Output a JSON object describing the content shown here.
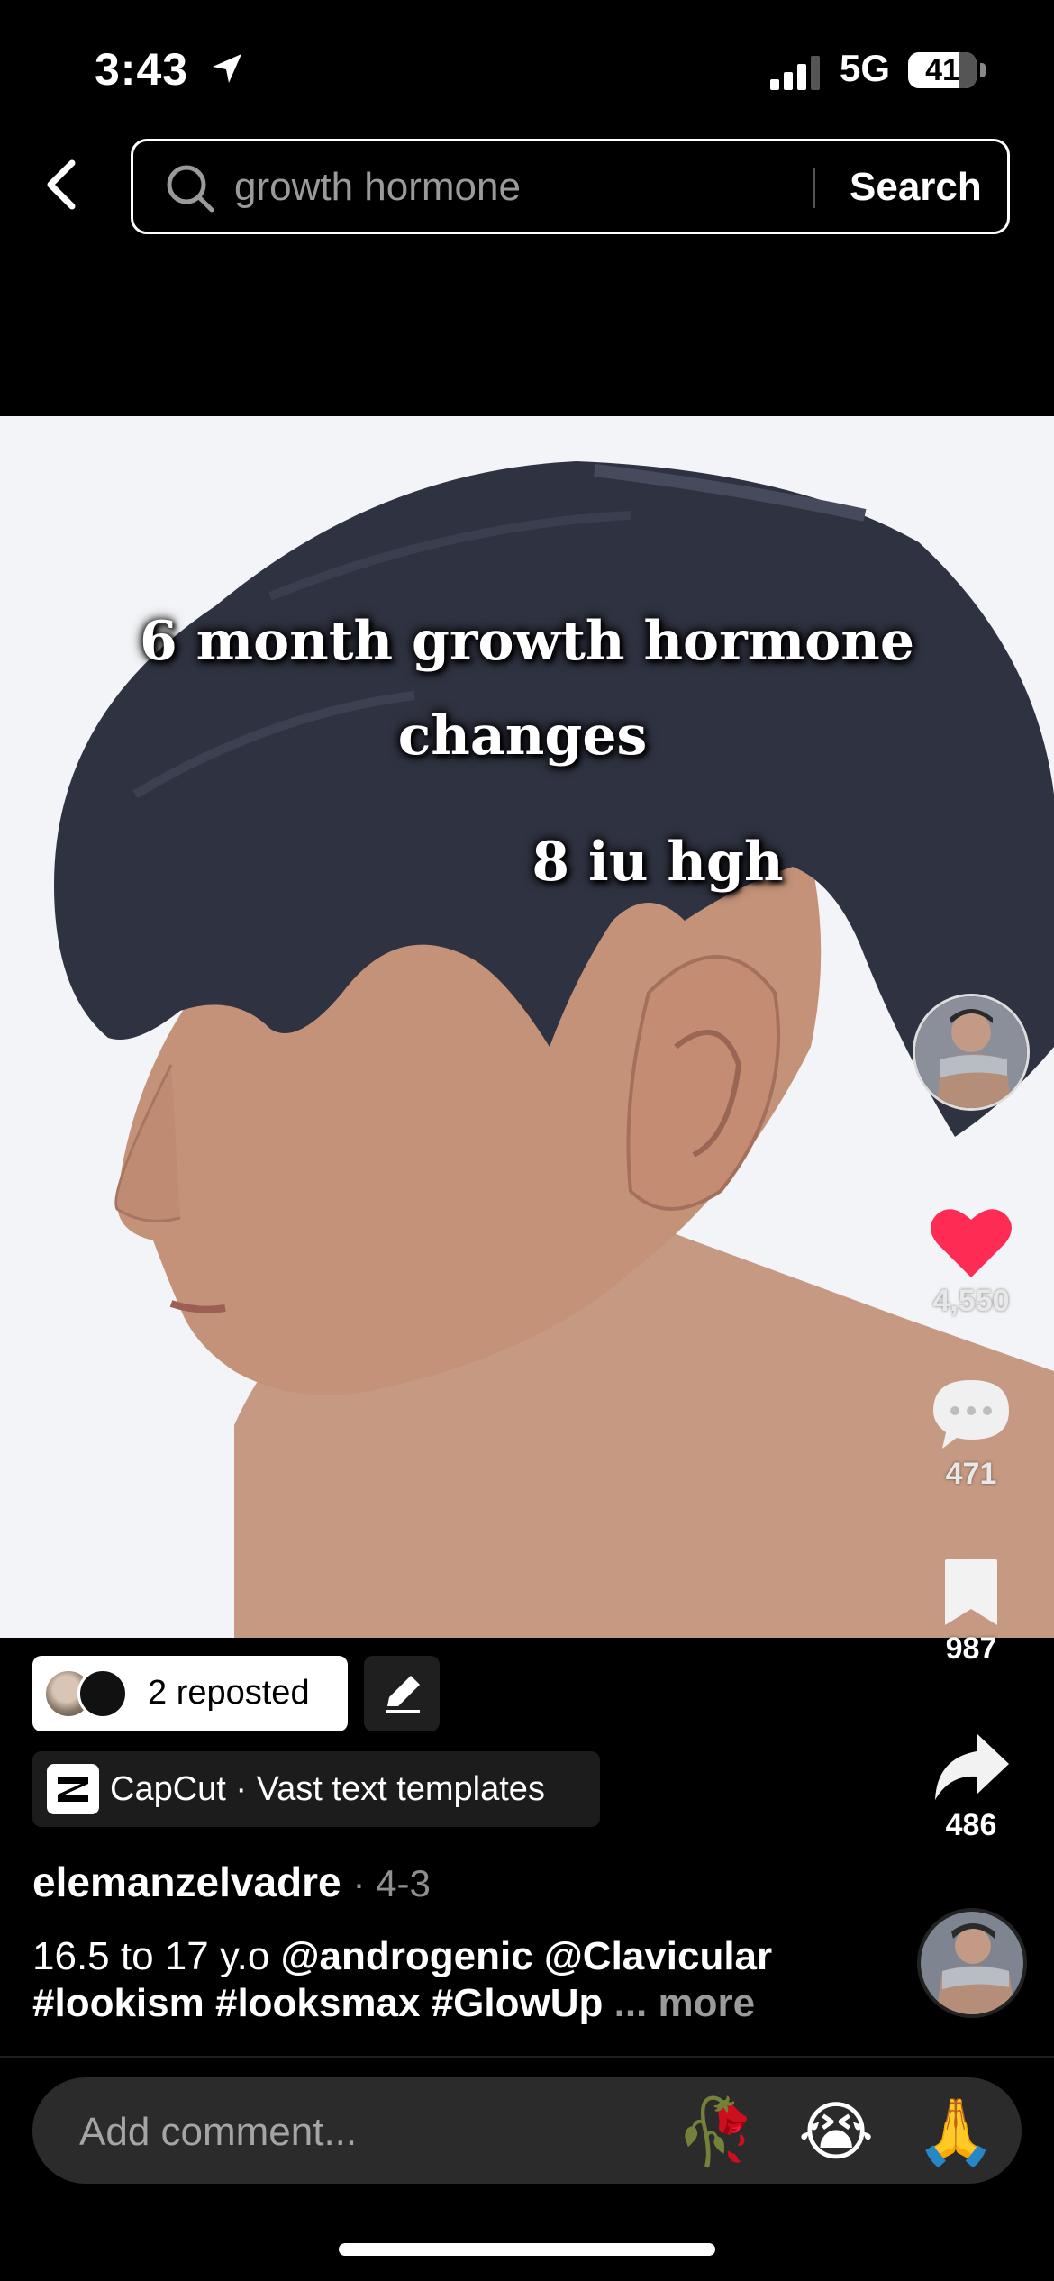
{
  "status_bar": {
    "time": "3:43",
    "network": "5G",
    "battery": "41"
  },
  "search": {
    "query": "growth hormone",
    "button_label": "Search"
  },
  "video": {
    "overlay_lines": [
      "6 month growth hormone",
      "changes",
      "8 iu hgh"
    ]
  },
  "actions": {
    "likes": "4,550",
    "comments": "471",
    "saves": "987",
    "shares": "486",
    "like_color": "#fe2c55"
  },
  "repost": {
    "label": "2 reposted"
  },
  "effect": {
    "label": "CapCut · Vast text templates"
  },
  "post": {
    "author": "elemanzelvadre",
    "date": "· 4-3",
    "caption_plain": "16.5 to 17 y.o ",
    "mention_1": "@androgenic",
    "mention_2": "@Clavicular",
    "hashtag_1": "#lookism",
    "hashtag_2": "#looksmax",
    "hashtag_3": "#GlowUp",
    "ellipsis": " ... ",
    "more_label": "more"
  },
  "comment_bar": {
    "placeholder": "Add comment...",
    "emojis": [
      "🥀",
      "😭",
      "🙏"
    ]
  }
}
